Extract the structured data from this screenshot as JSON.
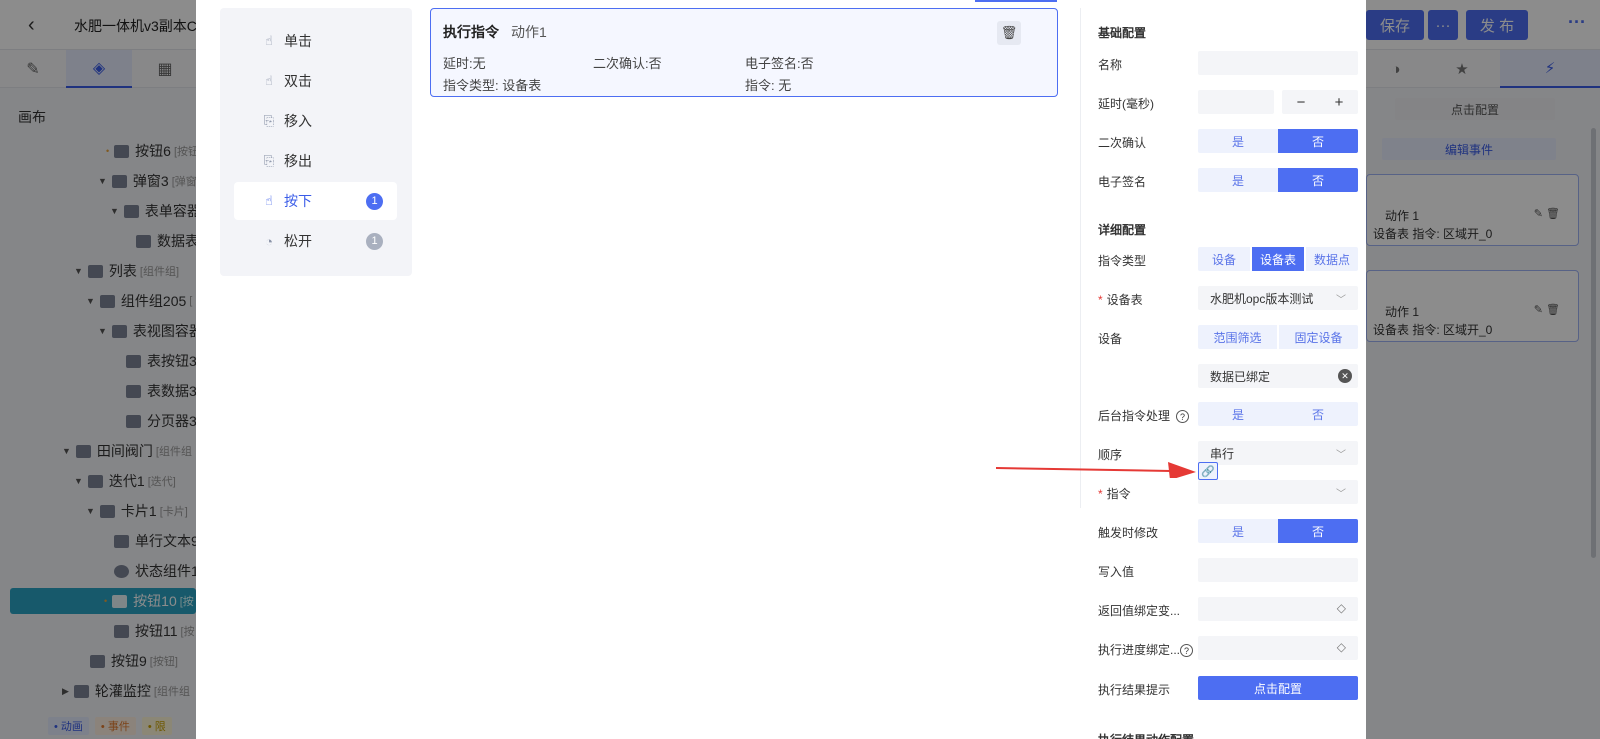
{
  "header": {
    "back_icon": "back-arrow-icon",
    "title": "水肥一体机v3副本C",
    "save_label": "保存",
    "more_label": "···",
    "publish_label": "发 布",
    "overflow_label": "···"
  },
  "left_tabs": [
    "brush-icon",
    "layers-icon",
    "component-icon"
  ],
  "right_tabs": [
    "style-icon",
    "star-icon",
    "lightning-icon"
  ],
  "canvas": {
    "label": "画布",
    "tree": [
      {
        "label": "按钮6",
        "tag": "[按钮"
      },
      {
        "label": "弹窗3",
        "tag": "[弹窗"
      },
      {
        "label": "表单容器",
        "tag": ""
      },
      {
        "label": "数据表",
        "tag": ""
      },
      {
        "label": "列表",
        "tag": "[组件组]"
      },
      {
        "label": "组件组205",
        "tag": "["
      },
      {
        "label": "表视图容器",
        "tag": ""
      },
      {
        "label": "表按钮3",
        "tag": ""
      },
      {
        "label": "表数据3",
        "tag": ""
      },
      {
        "label": "分页器3",
        "tag": ""
      },
      {
        "label": "田间阀门",
        "tag": "[组件组"
      },
      {
        "label": "迭代1",
        "tag": "[迭代]"
      },
      {
        "label": "卡片1",
        "tag": "[卡片]"
      },
      {
        "label": "单行文本9",
        "tag": ""
      },
      {
        "label": "状态组件1",
        "tag": ""
      },
      {
        "label": "按钮10",
        "tag": "[按"
      },
      {
        "label": "按钮11",
        "tag": "[按"
      },
      {
        "label": "按钮9",
        "tag": "[按钮]"
      },
      {
        "label": "轮灌监控",
        "tag": "[组件组"
      }
    ],
    "legend": [
      "• 动画",
      "• 事件",
      "• 限"
    ]
  },
  "right_panel": {
    "config_label": "点击配置",
    "edit_event_label": "编辑事件",
    "cards": [
      {
        "action": "动作 1",
        "line": "设备表   指令:  区域开_0"
      },
      {
        "action": "动作 1",
        "line": "设备表   指令:  区域开_0"
      }
    ]
  },
  "events": [
    {
      "label": "单击",
      "icon": "tap-icon",
      "count": null
    },
    {
      "label": "双击",
      "icon": "double-tap-icon",
      "count": null
    },
    {
      "label": "移入",
      "icon": "move-in-icon",
      "count": null
    },
    {
      "label": "移出",
      "icon": "move-out-icon",
      "count": null
    },
    {
      "label": "按下",
      "icon": "press-icon",
      "count": "1",
      "active": true
    },
    {
      "label": "松开",
      "icon": "release-icon",
      "count": "1"
    }
  ],
  "action": {
    "type": "执行指令",
    "name": "动作1",
    "delay": "延时:无",
    "confirm": "二次确认:否",
    "esign": "电子签名:否",
    "cmd_type": "指令类型: 设备表",
    "cmd": "指令: 无"
  },
  "config": {
    "basic_title": "基础配置",
    "name_label": "名称",
    "name_value": "",
    "delay_label": "延时(毫秒)",
    "delay_value": "",
    "minus": "−",
    "plus": "+",
    "confirm_label": "二次确认",
    "esign_label": "电子签名",
    "yes": "是",
    "no": "否",
    "detail_title": "详细配置",
    "cmd_type_label": "指令类型",
    "cmd_types": [
      "设备",
      "设备表",
      "数据点"
    ],
    "device_table_label": "设备表",
    "device_table_value": "水肥机opc版本测试",
    "device_label": "设备",
    "device_modes": [
      "范围筛选",
      "固定设备"
    ],
    "bound_value": "数据已绑定",
    "backend_label": "后台指令处理",
    "order_label": "顺序",
    "order_value": "串行",
    "cmd_label": "指令",
    "cmd_value": "",
    "trigger_modify_label": "触发时修改",
    "write_value_label": "写入值",
    "return_bind_label": "返回值绑定变...",
    "progress_bind_label": "执行进度绑定...",
    "result_tip_label": "执行结果提示",
    "result_tip_button": "点击配置",
    "footer_title": "执行结果动作配置"
  }
}
